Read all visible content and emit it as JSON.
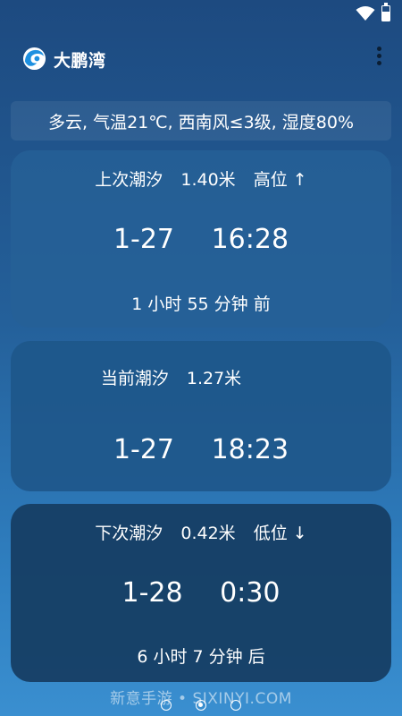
{
  "app": {
    "title": "大鹏湾"
  },
  "weather": {
    "summary": "多云, 气温21℃, 西南风≤3级, 湿度80%"
  },
  "tides": {
    "previous": {
      "label": "上次潮汐",
      "height": "1.40米",
      "level": "高位 ↑",
      "date": "1-27",
      "time": "16:28",
      "relative": "1 小时 55 分钟 前"
    },
    "current": {
      "label": "当前潮汐",
      "height": "1.27米",
      "date": "1-27",
      "time": "18:23"
    },
    "next": {
      "label": "下次潮汐",
      "height": "0.42米",
      "level": "低位 ↓",
      "date": "1-28",
      "time": "0:30",
      "relative": "6 小时 7 分钟 后"
    }
  },
  "pager": {
    "pages": 3,
    "active_index": 1
  },
  "watermark": "新意手游 • SIXINYI.COM",
  "icons": {
    "wifi": "wifi-icon",
    "battery": "battery-icon",
    "logo": "wave-logo-icon",
    "menu": "more-vert-icon"
  },
  "colors": {
    "background_top": "#1d4a80",
    "background_bottom": "#3a8fd0",
    "text": "#ffffff",
    "logo": "#1e90e0"
  }
}
